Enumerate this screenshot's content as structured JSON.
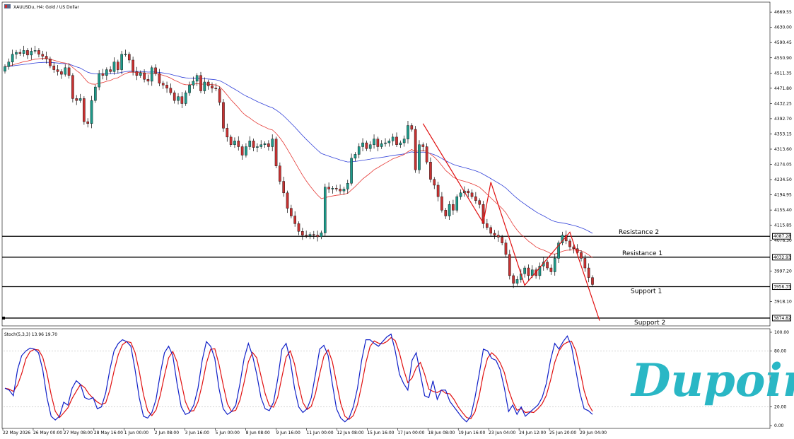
{
  "header": {
    "title": "XAUUSDu, H4:  Gold / US Dollar"
  },
  "colors": {
    "bull": "#1e9a8a",
    "bear": "#c83232",
    "ema_fast": "#e53935",
    "ema_slow": "#2f3fd8",
    "stoch_k": "#1020c8",
    "stoch_d": "#e01010",
    "trend": "#e01010",
    "logo": "#2ab7c5"
  },
  "logo": {
    "text": "Dupoin"
  },
  "chart_data": {
    "type": "candlestick",
    "title": "XAUUSDu, H4:  Gold / US Dollar",
    "ylim": [
      3860,
      4690
    ],
    "y_ticks": [
      "4669.55",
      "4630.00",
      "4590.45",
      "4550.90",
      "4511.35",
      "4471.80",
      "4432.25",
      "4392.70",
      "4353.15",
      "4313.60",
      "4274.05",
      "4234.50",
      "4194.95",
      "4155.40",
      "4115.85",
      "4076.30",
      "3997.20",
      "3918.10"
    ],
    "x_ticks": [
      "22 May 2026",
      "26 May 00:00",
      "27 May 08:00",
      "28 May 16:00",
      "1 Jun 00:00",
      "2 Jun 08:00",
      "3 Jun 16:00",
      "5 Jun 00:00",
      "8 Jun 08:00",
      "9 Jun 16:00",
      "11 Jun 00:00",
      "12 Jun 08:00",
      "15 Jun 16:00",
      "17 Jun 00:00",
      "18 Jun 08:00",
      "19 Jun 16:00",
      "23 Jun 04:00",
      "24 Jun 12:00",
      "25 Jun 20:00",
      "29 Jun 04:00"
    ],
    "levels": [
      {
        "name": "Resistance 2",
        "price": 4087.28,
        "badge": "4087.28"
      },
      {
        "name": "Resistance 1",
        "price": 4032.93,
        "badge": "4032.93"
      },
      {
        "name": "Support 1",
        "price": 3956.35,
        "badge": "3956.35"
      },
      {
        "name": "Support 2",
        "price": 3874.82,
        "badge": "3874.82"
      }
    ],
    "series": [
      {
        "name": "close",
        "values": [
          4528,
          4540,
          4560,
          4565,
          4562,
          4570,
          4558,
          4568,
          4570,
          4560,
          4555,
          4548,
          4530,
          4520,
          4515,
          4508,
          4525,
          4505,
          4445,
          4440,
          4445,
          4385,
          4380,
          4440,
          4475,
          4510,
          4505,
          4520,
          4515,
          4540,
          4520,
          4560,
          4560,
          4545,
          4515,
          4505,
          4512,
          4495,
          4490,
          4525,
          4510,
          4485,
          4480,
          4472,
          4460,
          4440,
          4450,
          4432,
          4460,
          4480,
          4490,
          4505,
          4465,
          4488,
          4478,
          4472,
          4470,
          4435,
          4368,
          4345,
          4325,
          4335,
          4320,
          4298,
          4320,
          4335,
          4318,
          4320,
          4325,
          4328,
          4320,
          4340,
          4270,
          4230,
          4200,
          4160,
          4140,
          4120,
          4100,
          4090,
          4088,
          4092,
          4090,
          4086,
          4096,
          4215,
          4210,
          4212,
          4210,
          4205,
          4210,
          4225,
          4290,
          4300,
          4320,
          4330,
          4315,
          4325,
          4340,
          4320,
          4328,
          4330,
          4335,
          4345,
          4325,
          4330,
          4340,
          4375,
          4365,
          4260,
          4325,
          4320,
          4280,
          4235,
          4220,
          4190,
          4155,
          4140,
          4170,
          4155,
          4190,
          4200,
          4205,
          4200,
          4190,
          4180,
          4170,
          4120,
          4110,
          4095,
          4090,
          4085,
          4070,
          4040,
          3985,
          3965,
          3975,
          3990,
          4005,
          3985,
          4000,
          3985,
          4010,
          4020,
          4005,
          3995,
          4030,
          4070,
          4090,
          4075,
          4060,
          4055,
          4045,
          4030,
          4005,
          3980,
          3962
        ],
        "open_note": ""
      },
      {
        "name": "EMA fast",
        "values": []
      },
      {
        "name": "EMA slow",
        "values": []
      }
    ],
    "stochastic": {
      "label": "Stoch(5,3,3) 13.96 19.70",
      "ylim": [
        0,
        100
      ],
      "y_ticks": [
        "100.00",
        "80.00",
        "20.00",
        "0.00"
      ],
      "k": [
        40,
        38,
        32,
        60,
        75,
        80,
        83,
        82,
        78,
        60,
        30,
        10,
        6,
        10,
        25,
        22,
        40,
        48,
        44,
        30,
        28,
        30,
        18,
        20,
        35,
        60,
        80,
        88,
        92,
        90,
        85,
        60,
        30,
        10,
        8,
        14,
        28,
        55,
        78,
        85,
        75,
        45,
        20,
        12,
        14,
        22,
        40,
        70,
        90,
        85,
        72,
        40,
        18,
        12,
        15,
        22,
        45,
        72,
        88,
        75,
        55,
        30,
        18,
        16,
        25,
        50,
        82,
        88,
        70,
        40,
        20,
        14,
        18,
        30,
        55,
        82,
        86,
        75,
        45,
        18,
        8,
        4,
        8,
        20,
        40,
        70,
        92,
        92,
        88,
        85,
        90,
        95,
        98,
        80,
        55,
        45,
        38,
        70,
        78,
        55,
        32,
        30,
        48,
        28,
        38,
        38,
        26,
        20,
        14,
        8,
        4,
        10,
        30,
        55,
        82,
        80,
        72,
        70,
        60,
        40,
        15,
        22,
        12,
        20,
        10,
        14,
        18,
        22,
        30,
        45,
        70,
        88,
        82,
        90,
        96,
        85,
        60,
        35,
        18,
        16,
        12
      ]
    }
  }
}
